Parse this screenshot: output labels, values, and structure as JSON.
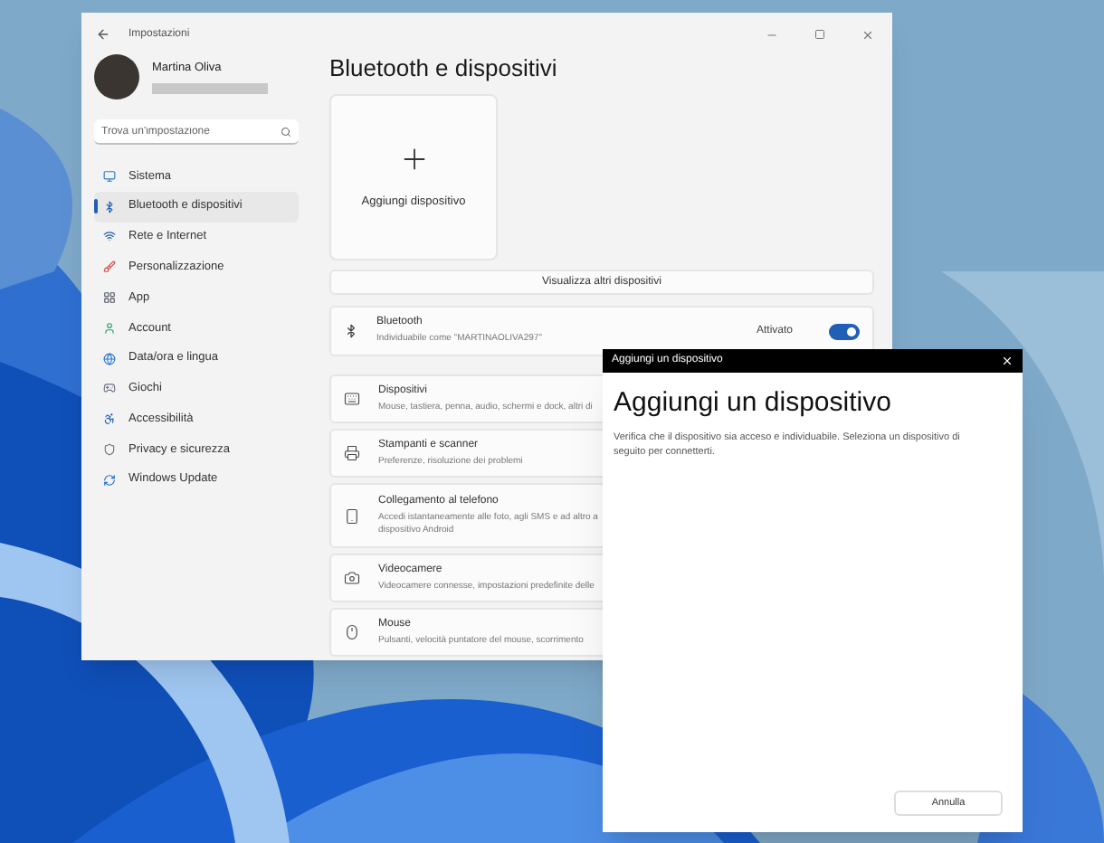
{
  "settings_window": {
    "title": "Impostazioni",
    "user": {
      "name": "Martina Oliva"
    },
    "search": {
      "placeholder": "Trova un'impostazione"
    },
    "sidebar": {
      "items": [
        {
          "label": "Sistema",
          "selected": false
        },
        {
          "label": "Bluetooth e dispositivi",
          "selected": true
        },
        {
          "label": "Rete e Internet",
          "selected": false
        },
        {
          "label": "Personalizzazione",
          "selected": false
        },
        {
          "label": "App",
          "selected": false
        },
        {
          "label": "Account",
          "selected": false
        },
        {
          "label": "Data/ora e lingua",
          "selected": false
        },
        {
          "label": "Giochi",
          "selected": false
        },
        {
          "label": "Accessibilità",
          "selected": false
        },
        {
          "label": "Privacy e sicurezza",
          "selected": false
        },
        {
          "label": "Windows Update",
          "selected": false
        }
      ]
    },
    "page_title": "Bluetooth e dispositivi",
    "add_tile": {
      "label": "Aggiungi dispositivo"
    },
    "show_more": "Visualizza altri dispositivi",
    "bluetooth": {
      "title": "Bluetooth",
      "subtitle": "Individuabile come \"MARTINAOLIVA297\"",
      "status": "Attivato",
      "on": true
    },
    "rows": [
      {
        "title": "Dispositivi",
        "subtitle_lines": [
          "Mouse, tastiera, penna, audio, schermi e dock, altri di"
        ]
      },
      {
        "title": "Stampanti e scanner",
        "subtitle_lines": [
          "Preferenze, risoluzione dei problemi"
        ]
      },
      {
        "title": "Collegamento al telefono",
        "subtitle_lines": [
          "Accedi istantaneamente alle foto, agli SMS e ad altro a",
          "dispositivo Android"
        ]
      },
      {
        "title": "Videocamere",
        "subtitle_lines": [
          "Videocamere connesse, impostazioni predefinite delle"
        ]
      },
      {
        "title": "Mouse",
        "subtitle_lines": [
          "Pulsanti, velocità puntatore del mouse, scorrimento"
        ]
      }
    ]
  },
  "dialog": {
    "title_bar": "Aggiungi un dispositivo",
    "heading": "Aggiungi un dispositivo",
    "text": "Verifica che il dispositivo sia acceso e individuabile. Seleziona un dispositivo di seguito per connetterti.",
    "button": "Annulla"
  }
}
